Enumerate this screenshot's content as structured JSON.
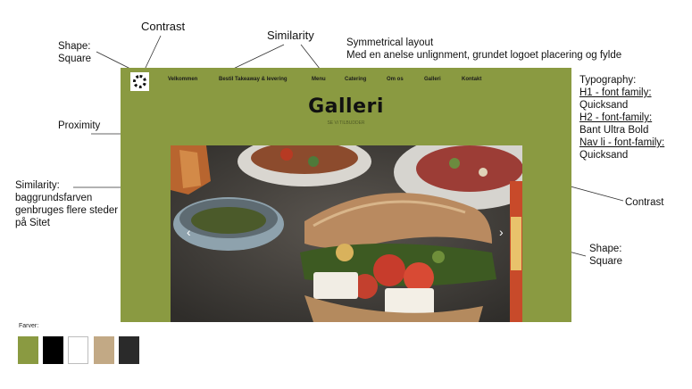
{
  "annotations": {
    "contrast_top": "Contrast",
    "shape_square_top_1": "Shape:",
    "shape_square_top_2": "Square",
    "similarity_top": "Similarity",
    "symmetry_1": "Symmetrical layout",
    "symmetry_2": "Med en anelse unlignment, grundet logoet placering og fylde",
    "proximity": "Proximity",
    "similarity_left_1": "Similarity:",
    "similarity_left_2": "baggrundsfarven",
    "similarity_left_3": "genbruges flere steder",
    "similarity_left_4": "på Sitet",
    "typo_title": "Typography:",
    "typo_h1_label": "H1 - font family:",
    "typo_h1_value": "Quicksand",
    "typo_h2_label": "H2 - font-family:",
    "typo_h2_value": "Bant Ultra Bold",
    "typo_nav_label": "Nav li - font-family:",
    "typo_nav_value": "Quicksand",
    "contrast_right": "Contrast",
    "shape_right_1": "Shape:",
    "shape_right_2": "Square"
  },
  "mockup": {
    "nav": [
      "Velkommen",
      "Bestil Takeaway & levering",
      "Menu",
      "Catering",
      "Om os",
      "Galleri",
      "Kontakt"
    ],
    "h1": "Galleri",
    "h2": "SE Vi TILBUDDER",
    "prev_arrow": "‹",
    "next_arrow": "›"
  },
  "palette": {
    "label": "Farver:",
    "colors": [
      "#8a9a41",
      "#000000",
      "#ffffff",
      "#c2a985",
      "#2a2a2a"
    ]
  }
}
